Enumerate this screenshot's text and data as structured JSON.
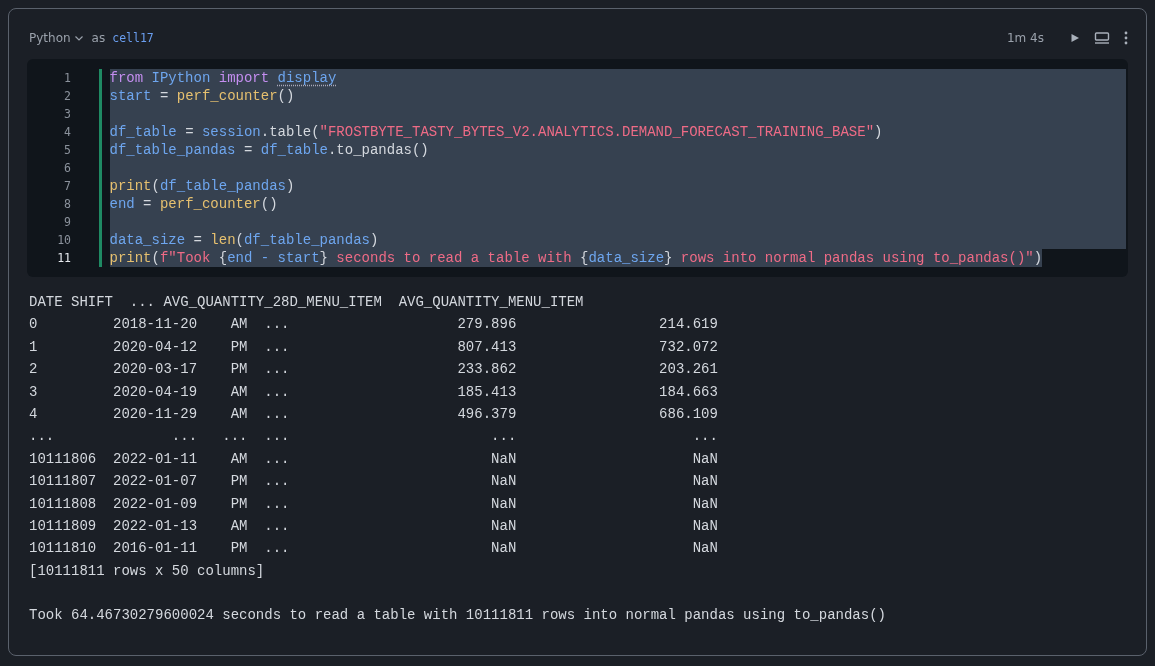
{
  "cell": {
    "language": "Python",
    "as_label": "as",
    "name": "cell17",
    "duration": "1m 4s"
  },
  "code": [
    {
      "number": "1",
      "kind": "full",
      "active": false,
      "tokens": [
        {
          "kind": "kw",
          "text": "from "
        },
        {
          "kind": "name",
          "text": "IPython "
        },
        {
          "kind": "kw",
          "text": "import "
        },
        {
          "kind": "hint",
          "text": "display"
        }
      ]
    },
    {
      "number": "2",
      "kind": "full",
      "active": false,
      "tokens": [
        {
          "kind": "name",
          "text": "start "
        },
        {
          "kind": "plain",
          "text": "= "
        },
        {
          "kind": "fn",
          "text": "perf_counter"
        },
        {
          "kind": "plain",
          "text": "()"
        }
      ]
    },
    {
      "number": "3",
      "kind": "full",
      "active": false
    },
    {
      "number": "4",
      "kind": "full",
      "active": false,
      "tokens": [
        {
          "kind": "name",
          "text": "df_table "
        },
        {
          "kind": "plain",
          "text": "= "
        },
        {
          "kind": "name",
          "text": "session"
        },
        {
          "kind": "plain",
          "text": ".table("
        },
        {
          "kind": "str",
          "text": "\"FROSTBYTE_TASTY_BYTES_V2.ANALYTICS.DEMAND_FORECAST_TRAINING_BASE\""
        },
        {
          "kind": "plain",
          "text": ")"
        }
      ]
    },
    {
      "number": "5",
      "kind": "full",
      "active": false,
      "tokens": [
        {
          "kind": "name",
          "text": "df_table_pandas "
        },
        {
          "kind": "plain",
          "text": "= "
        },
        {
          "kind": "name",
          "text": "df_table"
        },
        {
          "kind": "plain",
          "text": ".to_pandas()"
        }
      ]
    },
    {
      "number": "6",
      "kind": "full",
      "active": false
    },
    {
      "number": "7",
      "kind": "full",
      "active": false,
      "tokens": [
        {
          "kind": "fn",
          "text": "print"
        },
        {
          "kind": "plain",
          "text": "("
        },
        {
          "kind": "name",
          "text": "df_table_pandas"
        },
        {
          "kind": "plain",
          "text": ")"
        }
      ]
    },
    {
      "number": "8",
      "kind": "full",
      "active": false,
      "tokens": [
        {
          "kind": "name",
          "text": "end "
        },
        {
          "kind": "plain",
          "text": "= "
        },
        {
          "kind": "fn",
          "text": "perf_counter"
        },
        {
          "kind": "plain",
          "text": "()"
        }
      ]
    },
    {
      "number": "9",
      "kind": "full",
      "active": false
    },
    {
      "number": "10",
      "kind": "full",
      "active": false,
      "tokens": [
        {
          "kind": "name",
          "text": "data_size "
        },
        {
          "kind": "plain",
          "text": "= "
        },
        {
          "kind": "fn",
          "text": "len"
        },
        {
          "kind": "plain",
          "text": "("
        },
        {
          "kind": "name",
          "text": "df_table_pandas"
        },
        {
          "kind": "plain",
          "text": ")"
        }
      ]
    },
    {
      "number": "11",
      "kind": "partial",
      "active": true,
      "tokens": [
        {
          "kind": "fn",
          "text": "print"
        },
        {
          "kind": "plain",
          "text": "("
        },
        {
          "kind": "str",
          "text": "f\"Took "
        },
        {
          "kind": "plain",
          "text": "{"
        },
        {
          "kind": "name",
          "text": "end - start"
        },
        {
          "kind": "plain",
          "text": "}"
        },
        {
          "kind": "str",
          "text": " seconds to read a table with "
        },
        {
          "kind": "plain",
          "text": "{"
        },
        {
          "kind": "name",
          "text": "data_size"
        },
        {
          "kind": "plain",
          "text": "}"
        },
        {
          "kind": "str",
          "text": " rows into normal pandas using to_pandas()\""
        },
        {
          "kind": "plain",
          "text": ")"
        }
      ]
    }
  ],
  "output": [
    "DATE SHIFT  ... AVG_QUANTITY_28D_MENU_ITEM  AVG_QUANTITY_MENU_ITEM",
    "0         2018-11-20    AM  ...                    279.896                 214.619",
    "1         2020-04-12    PM  ...                    807.413                 732.072",
    "2         2020-03-17    PM  ...                    233.862                 203.261",
    "3         2020-04-19    AM  ...                    185.413                 184.663",
    "4         2020-11-29    AM  ...                    496.379                 686.109",
    "...              ...   ...  ...                        ...                     ...",
    "10111806  2022-01-11    AM  ...                        NaN                     NaN",
    "10111807  2022-01-07    PM  ...                        NaN                     NaN",
    "10111808  2022-01-09    PM  ...                        NaN                     NaN",
    "10111809  2022-01-13    AM  ...                        NaN                     NaN",
    "10111810  2016-01-11    PM  ...                        NaN                     NaN",
    "[10111811 rows x 50 columns]"
  ],
  "summary": "Took 64.46730279600024 seconds to read a table with 10111811 rows into normal pandas using to_pandas()"
}
